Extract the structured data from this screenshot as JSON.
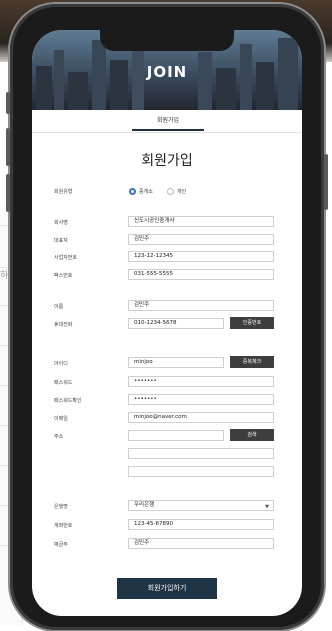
{
  "hero": {
    "title": "JOIN"
  },
  "tab": {
    "label": "회원가입"
  },
  "form": {
    "title": "회원가입",
    "member_type": {
      "label": "회원유형",
      "options": [
        "중개소",
        "개인"
      ],
      "selected": "중개소"
    },
    "company_name": {
      "label": "회사명",
      "value": "신도시공인중개사"
    },
    "ceo": {
      "label": "대표자",
      "value": "김민주"
    },
    "biz_no": {
      "label": "사업자번호",
      "value": "123-12-12345"
    },
    "fax": {
      "label": "팩스번호",
      "value": "031-555-5555"
    },
    "name": {
      "label": "이름",
      "value": "김민주"
    },
    "mobile": {
      "label": "휴대전화",
      "value": "010-1234-5678",
      "button": "인증번호"
    },
    "user_id": {
      "label": "아이디",
      "value": "minjoo",
      "button": "중복체크"
    },
    "password": {
      "label": "패스워드",
      "value": "•••••••"
    },
    "password_confirm": {
      "label": "패스워드확인",
      "value": "•••••••"
    },
    "email": {
      "label": "이메일",
      "value": "minjoo@naver.com"
    },
    "address": {
      "label": "주소",
      "button": "검색"
    },
    "bank": {
      "label": "은행명",
      "value": "우리은행"
    },
    "account_no": {
      "label": "계좌번호",
      "value": "123-45-67890"
    },
    "depositor": {
      "label": "예금주",
      "value": "김민주"
    },
    "submit": "회원가입하기"
  },
  "background": {
    "side_text": "하시"
  },
  "colors": {
    "navy": "#1f3546",
    "dark_button": "#3e3e3e",
    "radio_accent": "#3a6fb0"
  },
  "icons": {
    "select": "chevron-down-icon"
  }
}
